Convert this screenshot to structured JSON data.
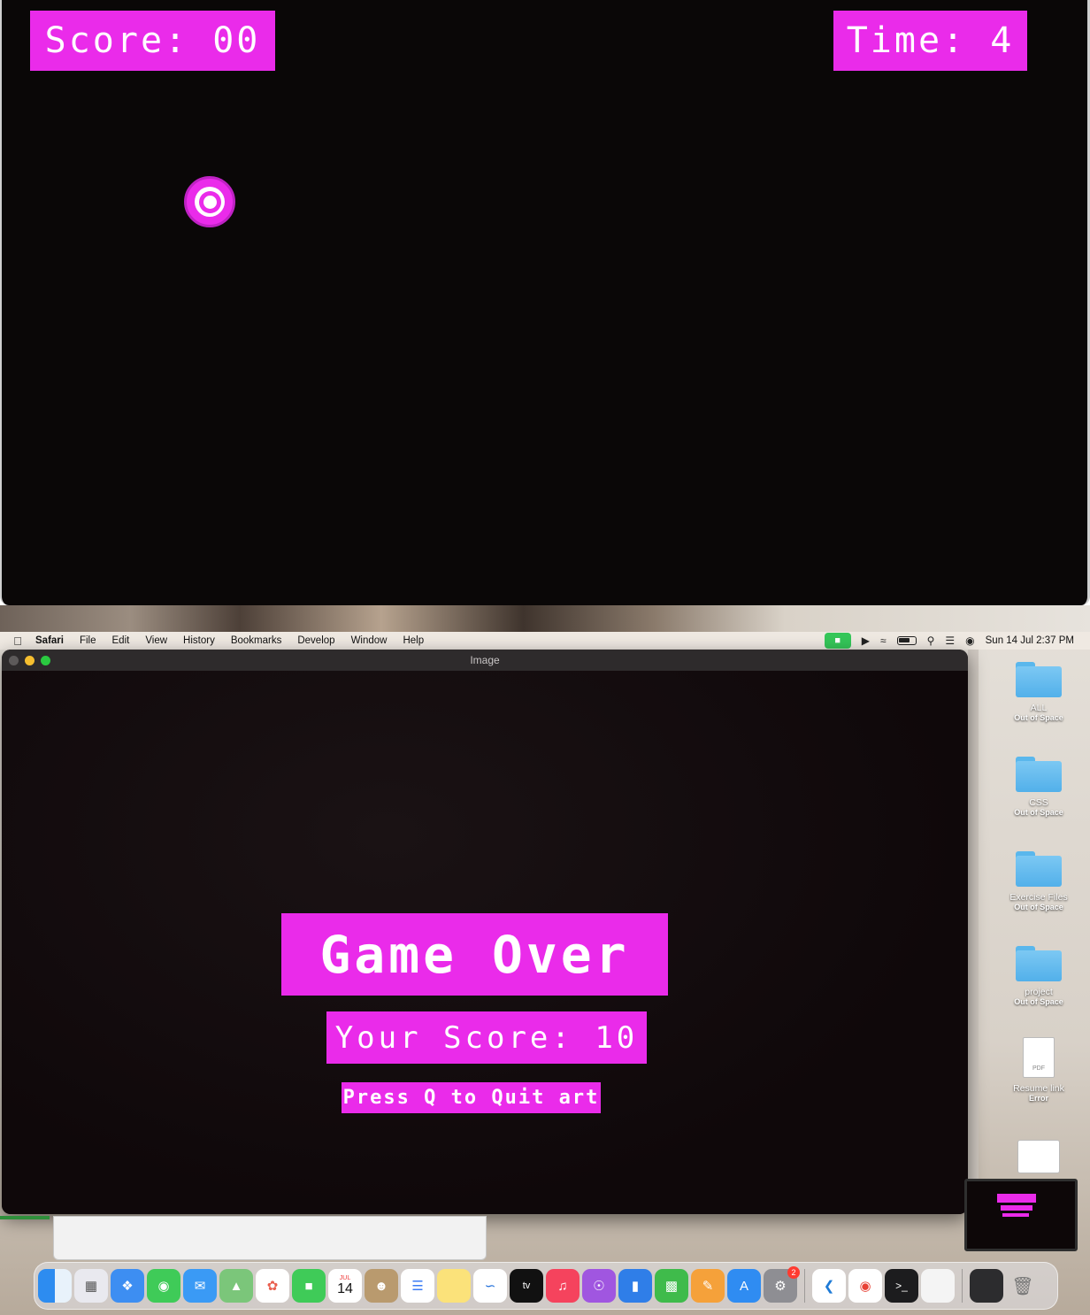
{
  "top_game": {
    "score_text": "Score: 00",
    "time_text": "Time: 4"
  },
  "menubar": {
    "app_name": "Safari",
    "items": [
      "File",
      "Edit",
      "View",
      "History",
      "Bookmarks",
      "Develop",
      "Window",
      "Help"
    ],
    "datetime": "Sun 14 Jul  2:37 PM"
  },
  "image_window": {
    "title": "Image",
    "game_over": "Game Over",
    "your_score": "Your Score: 10",
    "quit_prompt": "Press Q to Quit art"
  },
  "desktop_icons": [
    {
      "label": "ALL",
      "sub": "Out of Space"
    },
    {
      "label": "CSS",
      "sub": "Out of Space"
    },
    {
      "label": "Exercise Files",
      "sub": "Out of Space"
    },
    {
      "label": "project",
      "sub": "Out of Space"
    },
    {
      "label": "Resume link",
      "sub": "Error"
    }
  ],
  "pdf_tag": "PDF",
  "calendar": {
    "month": "JUL",
    "day": "14"
  },
  "settings_badge": "2",
  "dock_icons": [
    "finder-icon",
    "launchpad-icon",
    "safari-icon",
    "messages-icon",
    "mail-icon",
    "maps-icon",
    "photos-icon",
    "facetime-icon",
    "calendar-icon",
    "contacts-icon",
    "reminders-icon",
    "notes-icon",
    "freeform-icon",
    "tv-icon",
    "music-icon",
    "podcasts-icon",
    "keynote-icon",
    "numbers-icon",
    "pages-icon",
    "app-store-icon",
    "system-settings-icon",
    "vscode-icon",
    "chrome-icon",
    "terminal-icon",
    "document-icon",
    "screenshot-icon",
    "trash-icon"
  ],
  "colors": {
    "accent": "#ea2bea",
    "game_bg": "#0a0707"
  }
}
